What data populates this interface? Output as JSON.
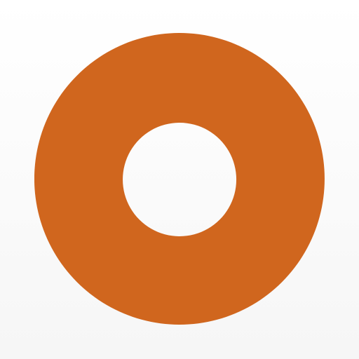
{
  "icon": {
    "name": "ring-icon",
    "colors": {
      "ring": "#d0661e",
      "hole": "#ffffff",
      "background_top": "#ffffff",
      "background_bottom": "#f6f6f6"
    }
  }
}
